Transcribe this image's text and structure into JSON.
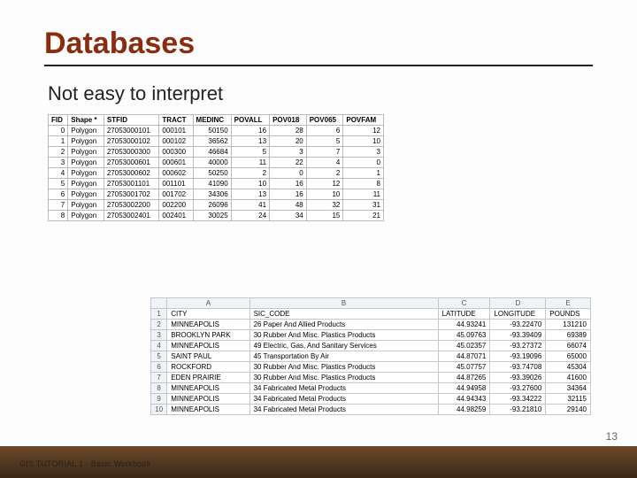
{
  "title": "Databases",
  "subtitle": "Not easy to interpret",
  "footer": "GIS TUTORIAL 1 - Basic Workbook",
  "page_number": "13",
  "table1": {
    "headers": [
      "FID",
      "Shape *",
      "STFID",
      "TRACT",
      "MEDINC",
      "POVALL",
      "POV018",
      "POV065",
      "POVFAM"
    ],
    "rows": [
      [
        "0",
        "Polygon",
        "27053000101",
        "000101",
        "50150",
        "16",
        "28",
        "6",
        "12"
      ],
      [
        "1",
        "Polygon",
        "27053000102",
        "000102",
        "36562",
        "13",
        "20",
        "5",
        "10"
      ],
      [
        "2",
        "Polygon",
        "27053000300",
        "000300",
        "46684",
        "5",
        "3",
        "7",
        "3"
      ],
      [
        "3",
        "Polygon",
        "27053000601",
        "000601",
        "40000",
        "11",
        "22",
        "4",
        "0"
      ],
      [
        "4",
        "Polygon",
        "27053000602",
        "000602",
        "50250",
        "2",
        "0",
        "2",
        "1"
      ],
      [
        "5",
        "Polygon",
        "27053001101",
        "001101",
        "41090",
        "10",
        "16",
        "12",
        "8"
      ],
      [
        "6",
        "Polygon",
        "27053001702",
        "001702",
        "34306",
        "13",
        "16",
        "10",
        "11"
      ],
      [
        "7",
        "Polygon",
        "27053002200",
        "002200",
        "26096",
        "41",
        "48",
        "32",
        "31"
      ],
      [
        "8",
        "Polygon",
        "27053002401",
        "002401",
        "30025",
        "24",
        "34",
        "15",
        "21"
      ]
    ]
  },
  "table2": {
    "col_headers": [
      "A",
      "B",
      "C",
      "D",
      "E"
    ],
    "row1_headers": [
      "CITY",
      "SIC_CODE",
      "LATITUDE",
      "LONGITUDE",
      "POUNDS"
    ],
    "rows": [
      [
        "2",
        "MINNEAPOLIS",
        "26 Paper And Allied Products",
        "44.93241",
        "-93.22470",
        "131210"
      ],
      [
        "3",
        "BROOKLYN PARK",
        "30 Rubber And Misc. Plastics Products",
        "45.09763",
        "-93.39409",
        "69389"
      ],
      [
        "4",
        "MINNEAPOLIS",
        "49 Electric, Gas, And Sanitary Services",
        "45.02357",
        "-93.27372",
        "66074"
      ],
      [
        "5",
        "SAINT PAUL",
        "45 Transportation By Air",
        "44.87071",
        "-93.19096",
        "65000"
      ],
      [
        "6",
        "ROCKFORD",
        "30 Rubber And Misc. Plastics Products",
        "45.07757",
        "-93.74708",
        "45304"
      ],
      [
        "7",
        "EDEN PRAIRIE",
        "30 Rubber And Misc. Plastics Products",
        "44.87265",
        "-93.39026",
        "41600"
      ],
      [
        "8",
        "MINNEAPOLIS",
        "34 Fabricated Metal Products",
        "44.94958",
        "-93.27600",
        "34364"
      ],
      [
        "9",
        "MINNEAPOLIS",
        "34 Fabricated Metal Products",
        "44.94343",
        "-93.34222",
        "32115"
      ],
      [
        "10",
        "MINNEAPOLIS",
        "34 Fabricated Metal Products",
        "44.98259",
        "-93.21810",
        "29140"
      ]
    ]
  }
}
